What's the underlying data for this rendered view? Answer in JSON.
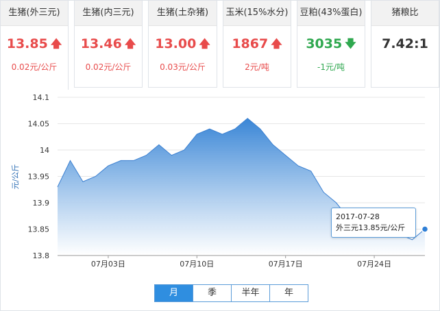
{
  "cards": [
    {
      "title": "生猪(外三元)",
      "price": "13.85",
      "change": "0.02元/公斤",
      "direction": "up"
    },
    {
      "title": "生猪(内三元)",
      "price": "13.46",
      "change": "0.02元/公斤",
      "direction": "up"
    },
    {
      "title": "生猪(土杂猪)",
      "price": "13.00",
      "change": "0.03元/公斤",
      "direction": "up"
    },
    {
      "title": "玉米(15%水分)",
      "price": "1867",
      "change": "2元/吨",
      "direction": "up"
    },
    {
      "title": "豆粕(43%蛋白)",
      "price": "3035",
      "change": "-1元/吨",
      "direction": "down"
    },
    {
      "title": "猪粮比",
      "price": "7.42:1",
      "change": "",
      "direction": "none"
    }
  ],
  "tooltip": {
    "date": "2017-07-28",
    "label": "外三元13.85元/公斤"
  },
  "tabs": [
    "月",
    "季",
    "半年",
    "年"
  ],
  "active_tab": "月",
  "colors": {
    "up": "#e84b4b",
    "down": "#2fa84f",
    "area_top": "#3a86d6",
    "area_bottom": "#ffffff",
    "accent": "#2f8ee0"
  },
  "chart_data": {
    "type": "area",
    "ylabel": "元/公斤",
    "ylim": [
      13.8,
      14.1
    ],
    "yticks": [
      "14.1",
      "14.05",
      "14",
      "13.95",
      "13.9",
      "13.85",
      "13.8"
    ],
    "xticks": [
      "07月03日",
      "07月10日",
      "07月17日",
      "07月24日"
    ],
    "x": [
      "06-29",
      "06-30",
      "07-01",
      "07-02",
      "07-03",
      "07-04",
      "07-05",
      "07-06",
      "07-07",
      "07-08",
      "07-09",
      "07-10",
      "07-11",
      "07-12",
      "07-13",
      "07-14",
      "07-15",
      "07-16",
      "07-17",
      "07-18",
      "07-19",
      "07-20",
      "07-21",
      "07-22",
      "07-23",
      "07-24",
      "07-25",
      "07-26",
      "07-27",
      "07-28"
    ],
    "values": [
      13.93,
      13.98,
      13.94,
      13.95,
      13.97,
      13.98,
      13.98,
      13.99,
      14.01,
      13.99,
      14.0,
      14.03,
      14.04,
      14.03,
      14.04,
      14.06,
      14.04,
      14.01,
      13.99,
      13.97,
      13.96,
      13.92,
      13.9,
      13.87,
      13.86,
      13.85,
      13.85,
      13.84,
      13.83,
      13.85
    ],
    "grid": true
  }
}
